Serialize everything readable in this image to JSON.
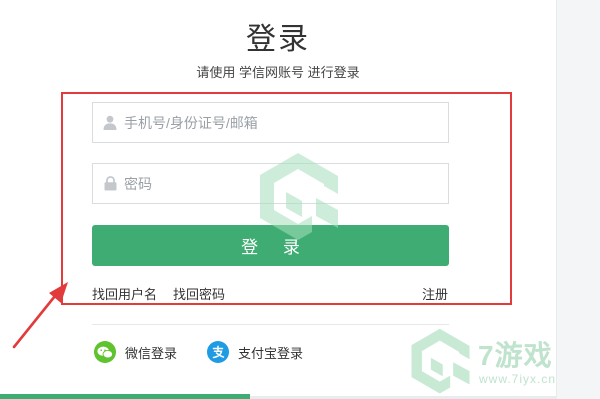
{
  "header": {
    "title": "登录",
    "subtitle": "请使用 学信网账号 进行登录"
  },
  "form": {
    "account_placeholder": "手机号/身份证号/邮箱",
    "password_placeholder": "密码",
    "login_label": "登 录"
  },
  "links": {
    "find_username": "找回用户名",
    "find_password": "找回密码",
    "register": "注册"
  },
  "social": {
    "wechat_label": "微信登录",
    "alipay_label": "支付宝登录"
  },
  "watermark": {
    "brand": "7游戏",
    "url": "www.7iyx.cn"
  },
  "colors": {
    "primary_green": "#3fad73",
    "highlight_red": "#e23b3b",
    "wechat_green": "#5fc22f",
    "alipay_blue": "#1f9be3"
  },
  "icons": [
    "user-icon",
    "lock-icon",
    "wechat-icon",
    "alipay-icon"
  ]
}
